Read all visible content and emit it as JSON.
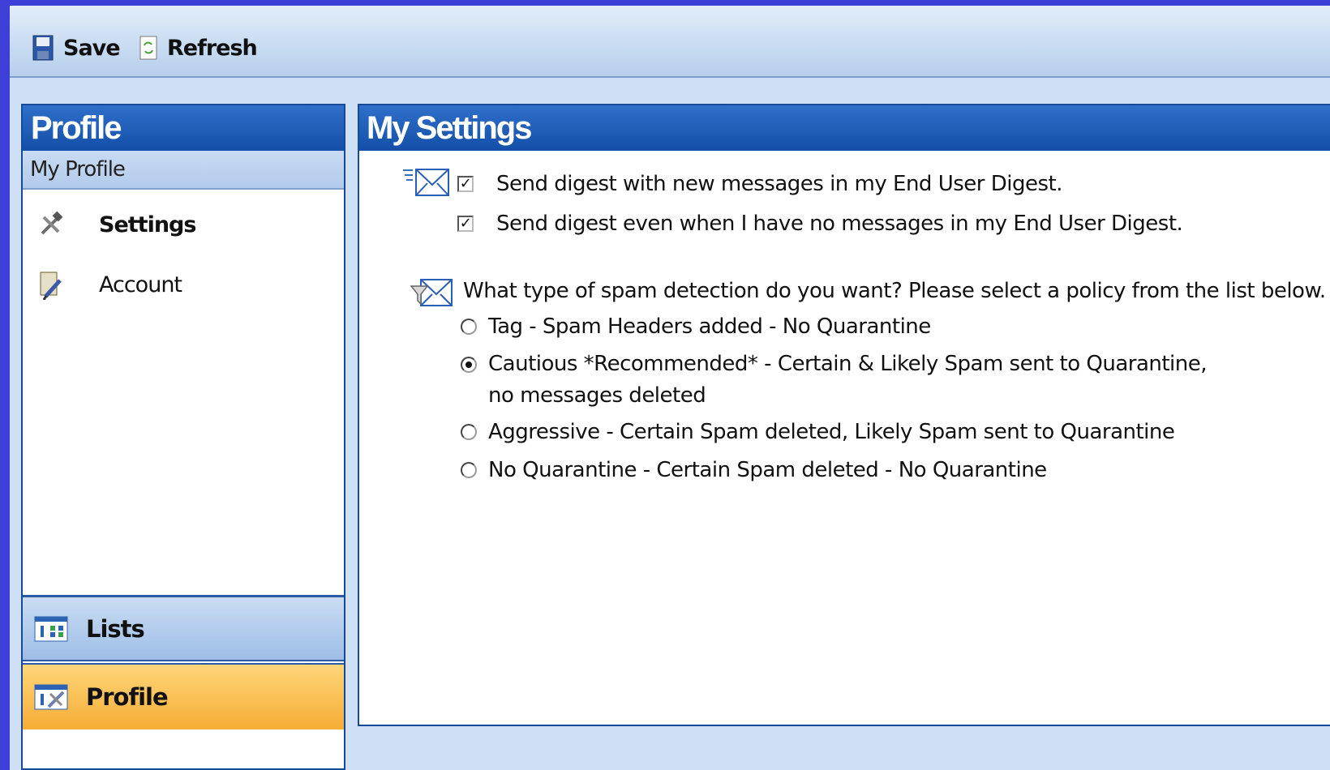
{
  "toolbar": {
    "save_label": "Save",
    "refresh_label": "Refresh"
  },
  "sidebar": {
    "title": "Profile",
    "subtitle": "My Profile",
    "items": [
      {
        "label": "Settings",
        "icon": "tools-icon",
        "selected": true
      },
      {
        "label": "Account",
        "icon": "account-icon",
        "selected": false
      }
    ],
    "bottom_buttons": [
      {
        "label": "Lists",
        "icon": "lists-icon",
        "active": false
      },
      {
        "label": "Profile",
        "icon": "profile-icon",
        "active": true
      }
    ]
  },
  "main": {
    "title": "My Settings",
    "digest": {
      "icon": "digest-envelope-icon",
      "options": [
        {
          "label": "Send digest with new messages in my End User Digest.",
          "checked": true
        },
        {
          "label": "Send digest even when I have no messages in my End User Digest.",
          "checked": true
        }
      ]
    },
    "spam": {
      "icon": "spam-filter-envelope-icon",
      "question": "What type of spam detection do you want? Please select a policy from the list below.",
      "options": [
        {
          "label": "Tag - Spam Headers added - No Quarantine",
          "selected": false
        },
        {
          "label": "Cautious *Recommended* - Certain & Likely Spam sent to Quarantine, no messages deleted",
          "selected": true
        },
        {
          "label": "Aggressive - Certain Spam deleted, Likely Spam sent to Quarantine",
          "selected": false
        },
        {
          "label": "No Quarantine - Certain Spam deleted - No Quarantine",
          "selected": false
        }
      ]
    }
  },
  "colors": {
    "frame": "#3d3fd6",
    "header_blue": "#134fa8",
    "active_orange": "#f6ad35"
  }
}
